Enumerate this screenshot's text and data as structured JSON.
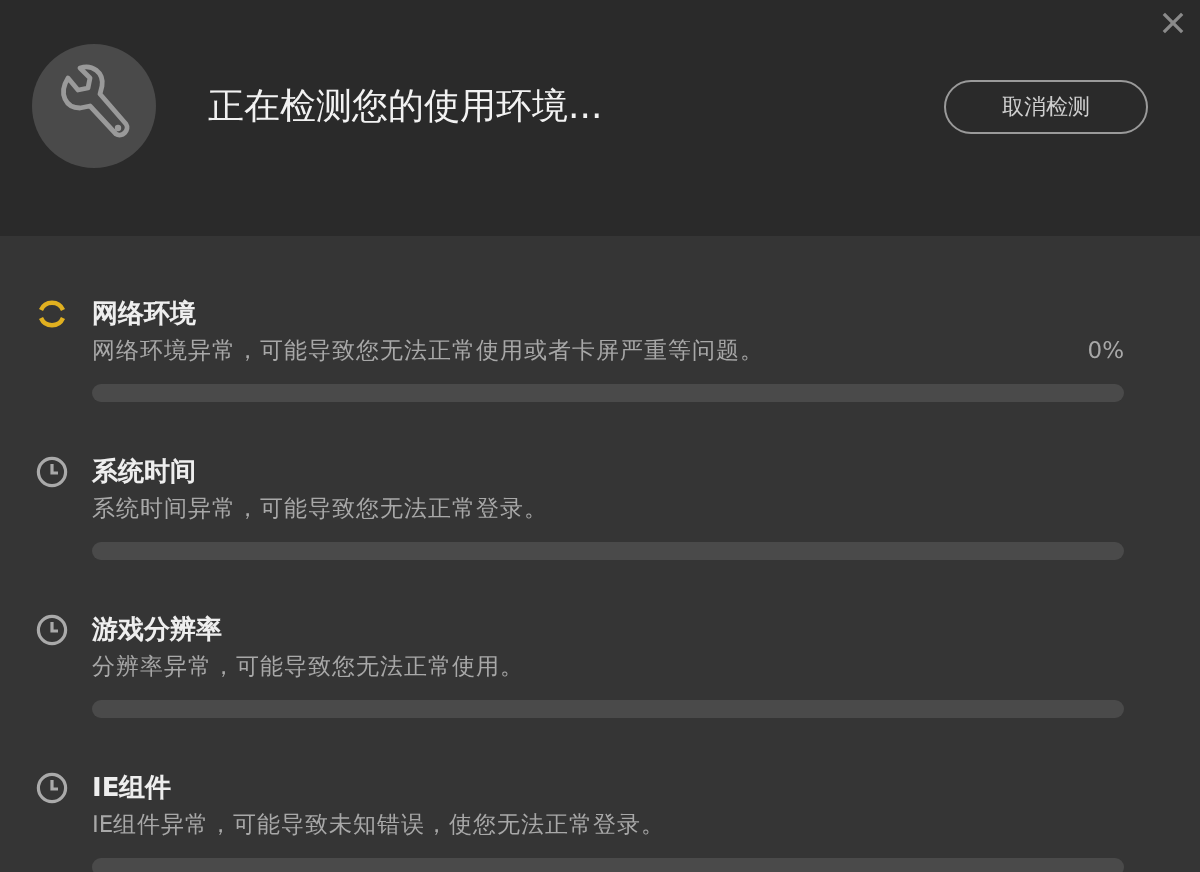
{
  "header": {
    "title": "正在检测您的使用环境...",
    "cancel_button": "取消检测"
  },
  "checks": [
    {
      "kind": "checking",
      "title": "网络环境",
      "description": "网络环境异常，可能导致您无法正常使用或者卡屏严重等问题。",
      "percent": "0%"
    },
    {
      "kind": "pending",
      "title": "系统时间",
      "description": "系统时间异常，可能导致您无法正常登录。"
    },
    {
      "kind": "pending",
      "title": "游戏分辨率",
      "description": "分辨率异常，可能导致您无法正常使用。"
    },
    {
      "kind": "pending",
      "title": "IE组件",
      "description": "IE组件异常，可能导致未知错误，使您无法正常登录。"
    }
  ]
}
